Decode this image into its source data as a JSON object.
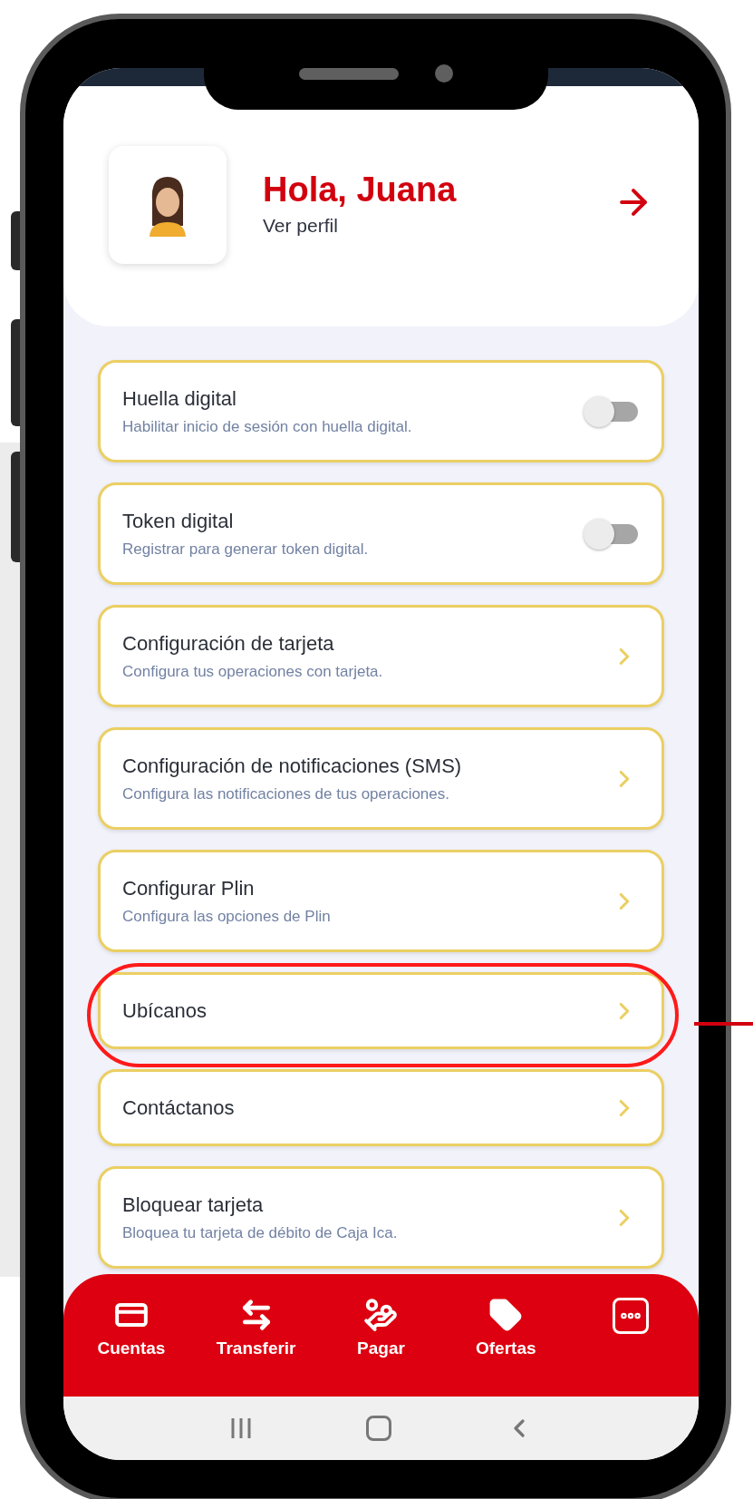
{
  "header": {
    "greeting": "Hola, Juana",
    "profile_link": "Ver perfil"
  },
  "settings": [
    {
      "kind": "toggle",
      "title": "Huella digital",
      "subtitle": "Habilitar inicio de sesión con huella digital.",
      "on": false
    },
    {
      "kind": "toggle",
      "title": "Token digital",
      "subtitle": "Registrar para generar token digital.",
      "on": false
    },
    {
      "kind": "link",
      "title": "Configuración de tarjeta",
      "subtitle": "Configura tus operaciones con tarjeta.",
      "highlighted": false
    },
    {
      "kind": "link",
      "title": "Configuración de notificaciones (SMS)",
      "subtitle": "Configura las notificaciones de tus operaciones.",
      "highlighted": false
    },
    {
      "kind": "link",
      "title": "Configurar Plin",
      "subtitle": "Configura las opciones de Plin",
      "highlighted": false
    },
    {
      "kind": "link",
      "title": "Ubícanos",
      "highlighted": true
    },
    {
      "kind": "link",
      "title": "Contáctanos",
      "highlighted": false
    },
    {
      "kind": "link",
      "title": "Bloquear tarjeta",
      "subtitle": "Bloquea tu tarjeta de débito de Caja Ica.",
      "highlighted": false
    }
  ],
  "bottom_nav": [
    {
      "kind": "cards",
      "label": "Cuentas"
    },
    {
      "kind": "transfer",
      "label": "Transferir"
    },
    {
      "kind": "pay",
      "label": "Pagar"
    },
    {
      "kind": "offers",
      "label": "Ofertas"
    },
    {
      "kind": "more"
    }
  ]
}
